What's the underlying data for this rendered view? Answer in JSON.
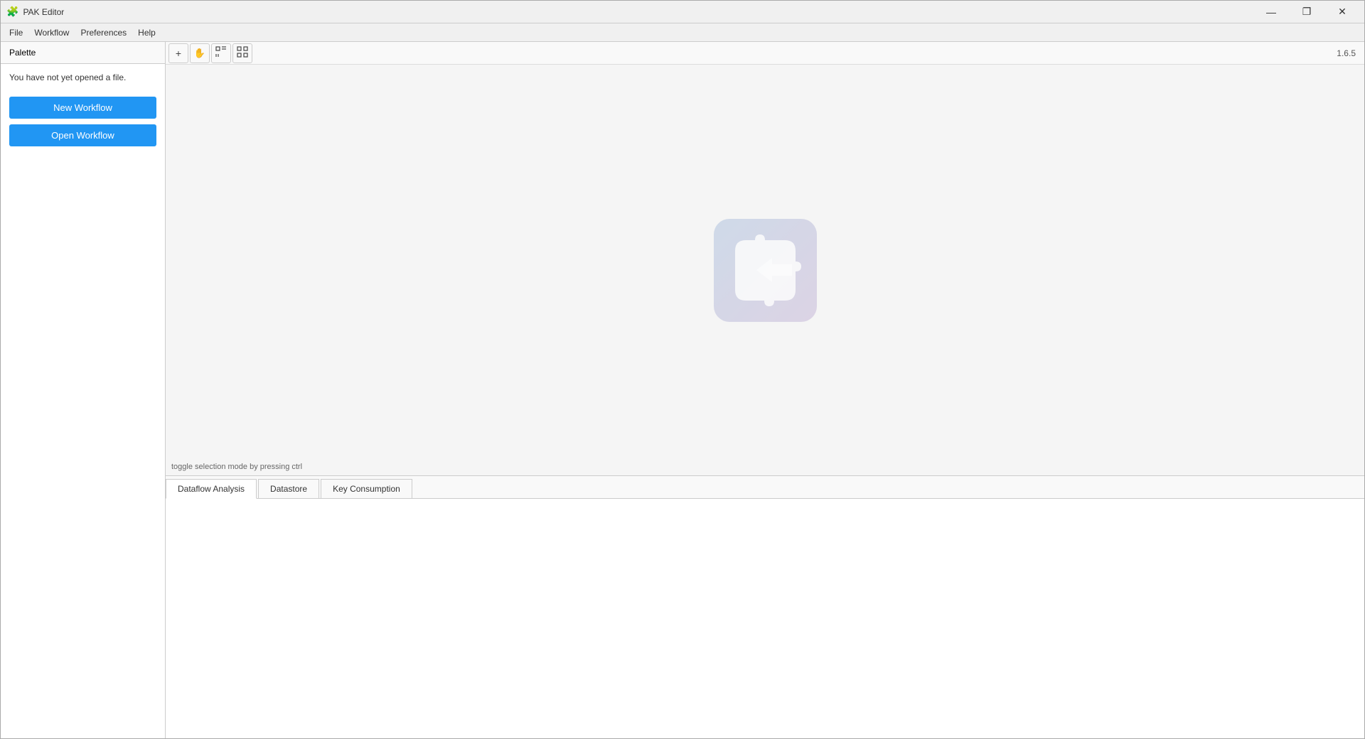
{
  "window": {
    "title": "PAK Editor",
    "icon": "🧩"
  },
  "titlebar": {
    "minimize_label": "—",
    "maximize_label": "❐",
    "close_label": "✕"
  },
  "menubar": {
    "items": [
      "File",
      "Workflow",
      "Preferences",
      "Help"
    ]
  },
  "toolbar": {
    "add_label": "+",
    "version": "1.6.5",
    "hand_icon": "✋",
    "select_icon": "⛶",
    "grid_icon": "⊞"
  },
  "sidebar": {
    "palette_tab": "Palette",
    "no_file_message": "You have not yet opened a file.",
    "new_workflow_label": "New Workflow",
    "open_workflow_label": "Open Workflow"
  },
  "canvas": {
    "status_text": "toggle selection mode by pressing ctrl"
  },
  "bottom_panel": {
    "tabs": [
      {
        "label": "Dataflow Analysis",
        "active": true
      },
      {
        "label": "Datastore",
        "active": false
      },
      {
        "label": "Key Consumption",
        "active": false
      }
    ]
  }
}
